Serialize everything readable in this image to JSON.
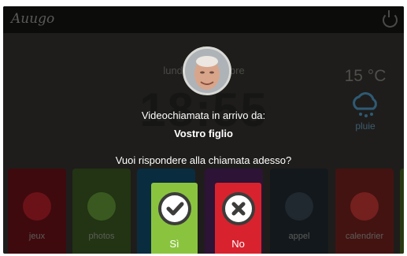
{
  "app": {
    "logo": "Auugo"
  },
  "background": {
    "date": "lundi 2 septembre",
    "time": "18:55",
    "weather": {
      "temperature": "15 °C",
      "condition": "pluie",
      "icon": "cloud-rain-icon"
    },
    "tiles": [
      {
        "label": "jeux",
        "icon": "chess-icon",
        "color": "#c2202b"
      },
      {
        "label": "photos",
        "icon": "image-icon",
        "color": "#6aa23a"
      },
      {
        "label": "",
        "icon": "tile-icon",
        "color": "#1e8ac5"
      },
      {
        "label": "",
        "icon": "tile-icon",
        "color": "#8e3aa5"
      },
      {
        "label": "appel",
        "icon": "phone-icon",
        "color": "#3b4a56"
      },
      {
        "label": "calendrier",
        "icon": "calendar-icon",
        "color": "#d23a36"
      },
      {
        "label": "",
        "icon": "tile-icon",
        "color": "#7fb335"
      }
    ]
  },
  "modal": {
    "title": "Videochiamata in arrivo da:",
    "caller": "Vostro figlio",
    "question": "Vuoi rispondere alla chiamata adesso?",
    "accept": {
      "label": "Sì",
      "icon": "checkmark-icon",
      "color": "#8ac43f"
    },
    "decline": {
      "label": "No",
      "icon": "close-icon",
      "color": "#d8232e"
    }
  }
}
